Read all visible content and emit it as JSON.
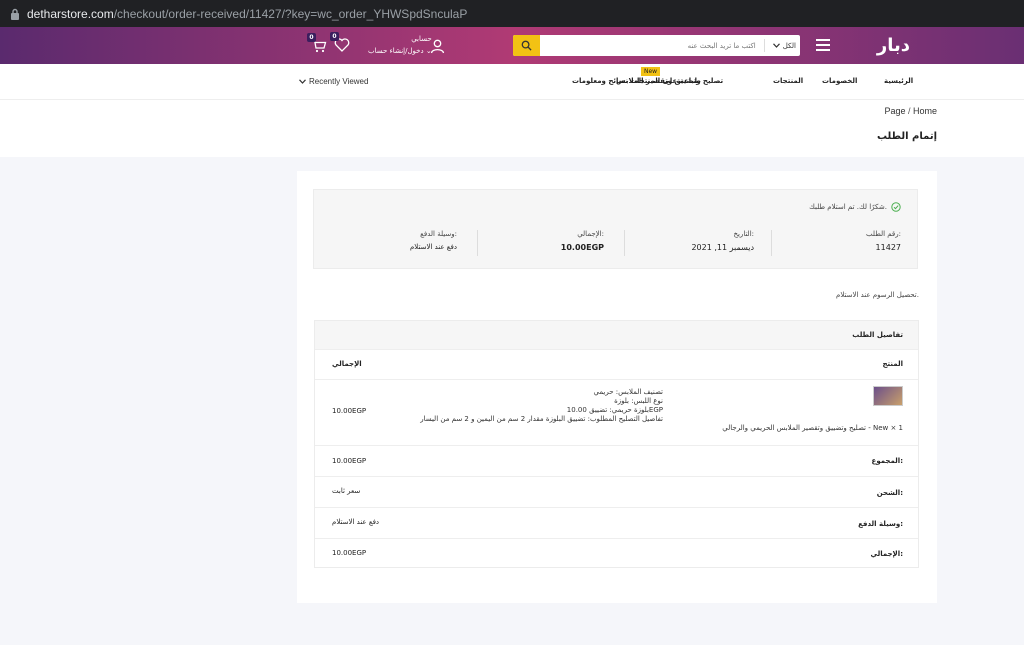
{
  "browser": {
    "host": "detharstore.com",
    "path": "/checkout/order-received/11427/?key=wc_order_YHWSpdSnculaP"
  },
  "header": {
    "logo": "دبار",
    "logo_sub": "",
    "search_placeholder": "اكتب ما تريد البحث عنه",
    "search_category": "الكل",
    "account_line1": "حسابي",
    "account_line2": "دخول/إنشاء حساب",
    "wishlist_count": "0",
    "cart_count": "0"
  },
  "nav": {
    "items": [
      "الرئيسية",
      "الخصومات",
      "المنتجات",
      "تصليح وتضييق وتقصير الملابس",
      "طباعة على المنتجات",
      "نصائح ومعلومات"
    ],
    "new_tag": "New",
    "recently_viewed": "Recently Viewed"
  },
  "breadcrumb": {
    "page": "Page",
    "home": "Home"
  },
  "page_title": "إتمام الطلب",
  "order": {
    "thanks": "شكرًا لك. تم استلام طلبك.",
    "number_label": "رقم الطلب:",
    "number": "11427",
    "date_label": "التاريخ:",
    "date": "ديسمبر 11, 2021",
    "total_label": "الإجمالي:",
    "total": "10.00EGP",
    "method_label": "وسيلة الدفع:",
    "method": "دفع عند الاستلام",
    "pay_note": "تحصيل الرسوم عند الاستلام."
  },
  "details": {
    "heading": "تفاصيل الطلب",
    "col_product": "المنتج",
    "col_total": "الإجمالي",
    "product_name": "تصليح وتضييق وتقصير الملابس الحريمي والرجالي - New × 1",
    "product_meta": [
      "تصنيف الملابس:  حريمي",
      "نوع اللبس:  بلوزة",
      "بلوزة حريمي:  تضييق 10.00EGP",
      "تفاصيل التصليح المطلوب:  تضييق البلوزة مقدار 2 سم من اليمين و 2 سم من اليسار"
    ],
    "product_total": "10.00EGP",
    "subtotal_label": "المجموع:",
    "subtotal": "10.00EGP",
    "shipping_label": "الشحن:",
    "shipping": "سعر ثابت",
    "payment_label": "وسيلة الدفع:",
    "payment": "دفع عند الاستلام",
    "grand_total_label": "الإجمالي:",
    "grand_total": "10.00EGP"
  }
}
